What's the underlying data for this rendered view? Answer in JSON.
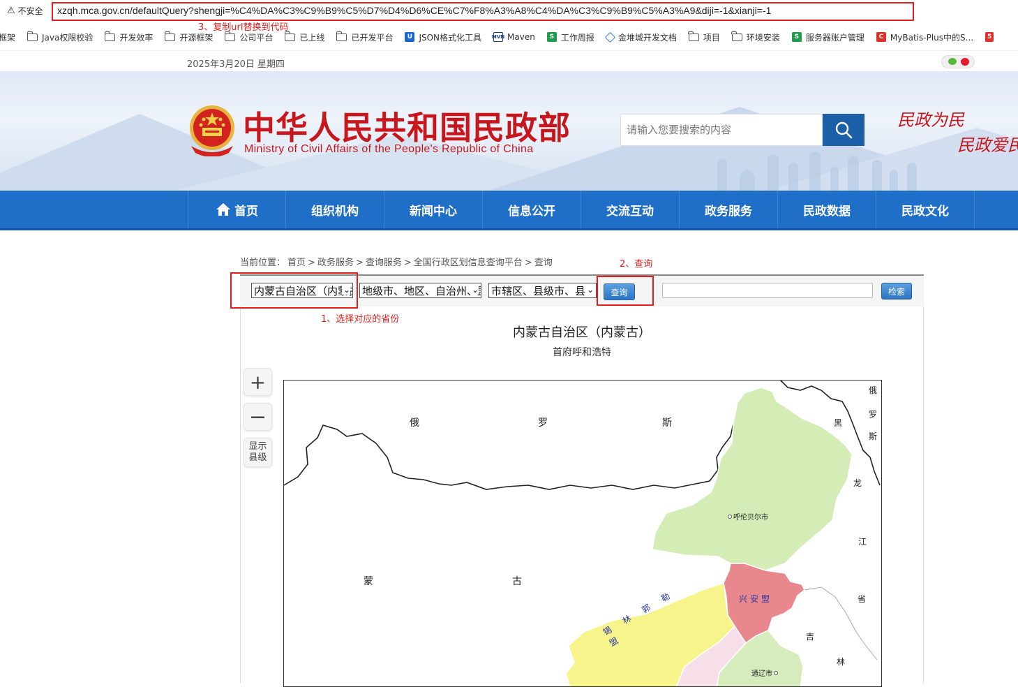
{
  "browser": {
    "security_label": "不安全",
    "url": "xzqh.mca.gov.cn/defaultQuery?shengji=%C4%DA%C3%C9%B9%C5%D7%D4%D6%CE%C7%F8%A3%A8%C4%DA%C3%C9%B9%C5%A3%A9&diji=-1&xianji=-1",
    "bookmarks": [
      {
        "label": "框架",
        "icon": "none"
      },
      {
        "label": "Java权限校验",
        "icon": "folder-icon"
      },
      {
        "label": "开发效率",
        "icon": "folder-icon"
      },
      {
        "label": "开源框架",
        "icon": "folder-icon"
      },
      {
        "label": "公司平台",
        "icon": "folder-icon"
      },
      {
        "label": "已上线",
        "icon": "folder-icon"
      },
      {
        "label": "已开发平台",
        "icon": "folder-icon"
      },
      {
        "label": "JSON格式化工具",
        "icon": "json-icon"
      },
      {
        "label": "Maven",
        "icon": "maven-icon"
      },
      {
        "label": "工作周报",
        "icon": "s-icon"
      },
      {
        "label": "金堆城开发文档",
        "icon": "doc-icon"
      },
      {
        "label": "项目",
        "icon": "folder-icon"
      },
      {
        "label": "环境安装",
        "icon": "folder-icon"
      },
      {
        "label": "服务器账户管理",
        "icon": "s-icon"
      },
      {
        "label": "MyBatis-Plus中的S...",
        "icon": "c-icon"
      }
    ]
  },
  "annotations": {
    "step1": "1、选择对应的省份",
    "step2": "2、查询",
    "step3": "3、复制url替换到代码"
  },
  "site": {
    "date": "2025年3月20日 星期四",
    "title_cn": "中华人民共和国民政部",
    "title_en": "Ministry of Civil Affairs of the People's Republic of China",
    "search_placeholder": "请输入您要搜索的内容",
    "slogan_line1": "民政为民",
    "slogan_line2": "民政爱民",
    "nav": [
      "首页",
      "组织机构",
      "新闻中心",
      "信息公开",
      "交流互动",
      "政务服务",
      "民政数据",
      "民政文化"
    ]
  },
  "breadcrumb": {
    "prefix": "当前位置：",
    "items": [
      "首页",
      "政务服务",
      "查询服务",
      "全国行政区划信息查询平台",
      "查询"
    ],
    "separator": ">"
  },
  "query": {
    "province_value": "内蒙古自治区（内蒙古）",
    "city_value": "地级市、地区、自治州、盟",
    "county_value": "市辖区、县级市、县",
    "query_label": "查询",
    "search_label": "检索",
    "keyword_value": ""
  },
  "region": {
    "name": "内蒙古自治区（内蒙古）",
    "capital": "首府呼和浩特"
  },
  "map_controls": {
    "zoom_in": "+",
    "zoom_out": "−",
    "show_county": "显示县级"
  },
  "map": {
    "labels": [
      "俄",
      "罗",
      "斯",
      "蒙",
      "古",
      "俄",
      "罗",
      "斯",
      "黑",
      "龙",
      "江",
      "省",
      "吉",
      "林"
    ],
    "cities": [
      "呼伦贝尔市",
      "兴安盟",
      "锡林郭勒盟",
      "通辽市"
    ],
    "colors": {
      "hulunbuir": "#d4ecb6",
      "xingan": "#e8878c",
      "xilingol": "#f6f48a",
      "tongliao": "#d6ecbd",
      "chifeng": "#f6dfe8"
    }
  }
}
